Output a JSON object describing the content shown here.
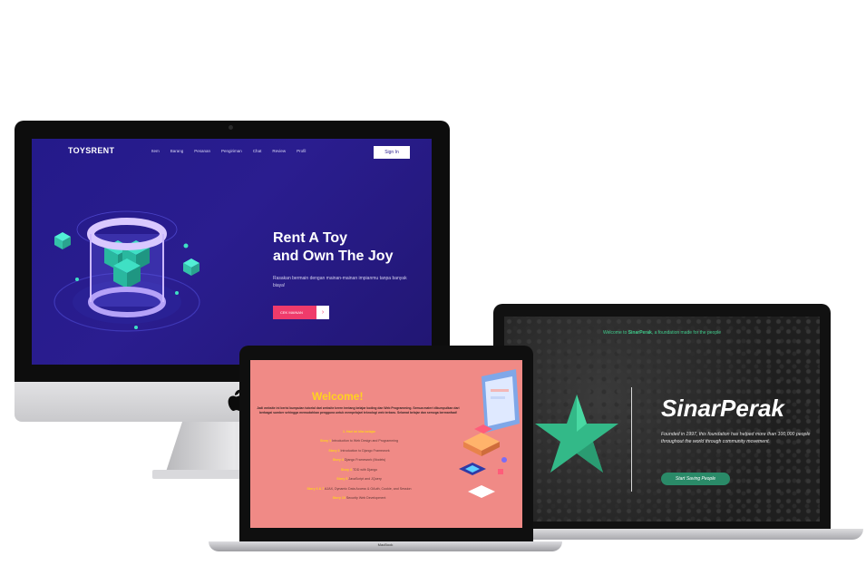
{
  "imac": {
    "site": {
      "logo": "TOYSRENT",
      "nav": [
        "Item",
        "Barang",
        "Pesanan",
        "Pengiriman",
        "Chat",
        "Review",
        "Profil"
      ],
      "signin": "Sign In",
      "headline_line1": "Rent A Toy",
      "headline_line2": "and Own The Joy",
      "subtitle": "Rasakan bermain dengan mainan-mainan impianmu tanpa banyak biaya!",
      "cta": "CEK MAINAN"
    }
  },
  "macbook_right": {
    "site": {
      "welcome_prefix": "Welcome to",
      "welcome_brand": "SinarPerak",
      "welcome_suffix": ", a foundation made for the people",
      "title": "SinarPerak",
      "description": "Founded in 1997, this foundation has helped more than 100,000 people throughout the world through community movement.",
      "cta": "Start Saving People",
      "accent_color": "#2a8a68"
    }
  },
  "macbook_front": {
    "brand": "MacBook",
    "site": {
      "title": "Welcome!",
      "intro": "Jadi website ini berisi kumpulan tutorial dari website keren tentang belajar koding dan Web Programming. Semua materi dikumpulkan dari berbagai sumber sehingga memudahkan pengguna untuk mempelajari teknologi web terbaru. Selamat belajar dan semoga bermanfaat!",
      "list_heading": "1. Hari ini kita belajar",
      "items": [
        {
          "tag": "Story 1",
          "text": "Introduction to Web Design and Programming"
        },
        {
          "tag": "Story 2",
          "text": "Introduction to Django Framework"
        },
        {
          "tag": "Story 3",
          "text": "Django Framework (Models)"
        },
        {
          "tag": "Story 4",
          "text": "TDD with Django"
        },
        {
          "tag": "Story 5",
          "text": "JavaScript and JQuery"
        },
        {
          "tag": "Story 6 & 7",
          "text": "AJAX, Dynamic Data Access & OAuth, Cookie, and Session"
        },
        {
          "tag": "Story 10",
          "text": "Security Web Development"
        }
      ]
    }
  }
}
